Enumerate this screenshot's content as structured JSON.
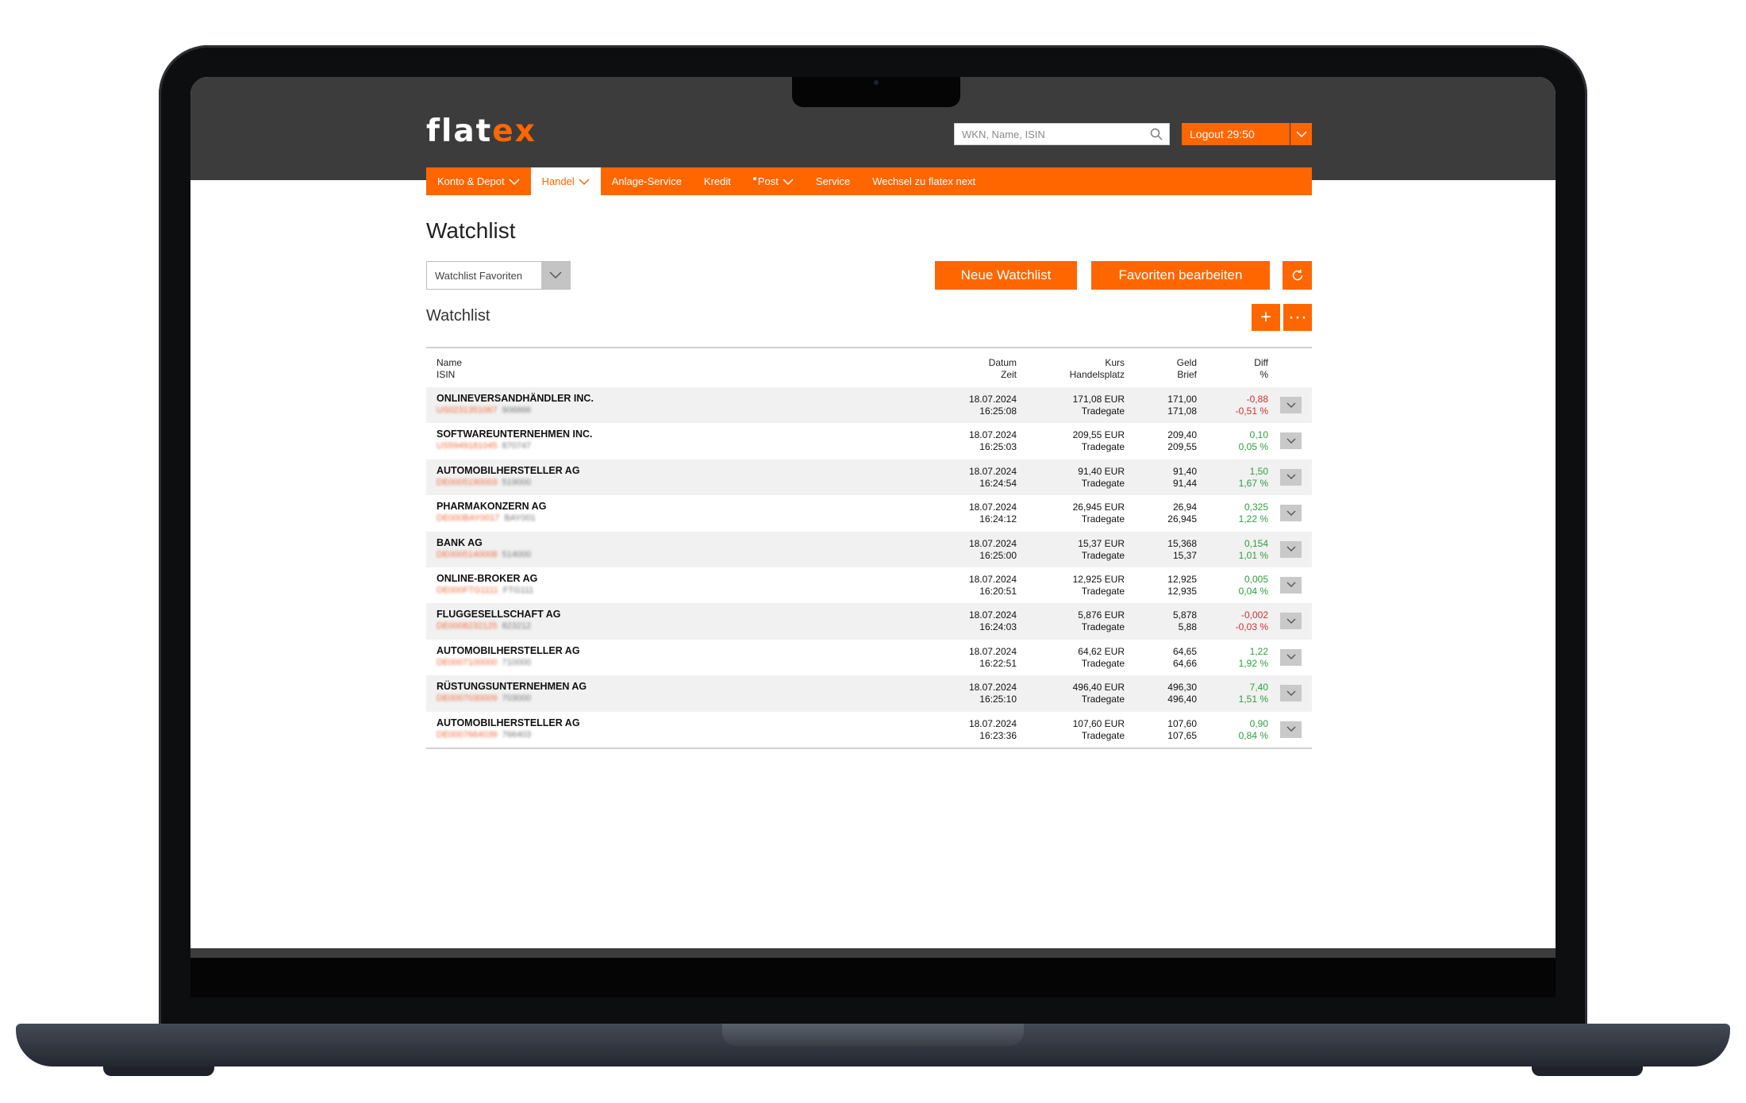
{
  "header": {
    "logo_text": "flat",
    "logo_accent": "ex",
    "search_placeholder": "WKN, Name, ISIN",
    "logout_label": "Logout  29:50"
  },
  "nav": {
    "items": [
      {
        "label": "Konto & Depot",
        "has_chevron": true
      },
      {
        "label": "Handel",
        "has_chevron": true,
        "active": true
      },
      {
        "label": "Anlage-Service"
      },
      {
        "label": "Kredit"
      },
      {
        "label": "Post",
        "has_chevron": true,
        "dot": true
      },
      {
        "label": "Service"
      },
      {
        "label": "Wechsel zu flatex next"
      }
    ]
  },
  "page": {
    "title": "Watchlist",
    "select_value": "Watchlist Favoriten",
    "btn_new": "Neue Watchlist",
    "btn_fav": "Favoriten bearbeiten",
    "section_title": "Watchlist",
    "btn_add": "+",
    "btn_more": "···"
  },
  "table": {
    "headers": {
      "name": "Name",
      "isin": "ISIN",
      "datum": "Datum",
      "zeit": "Zeit",
      "kurs": "Kurs",
      "handelsplatz": "Handelsplatz",
      "geld": "Geld",
      "brief": "Brief",
      "diff": "Diff",
      "pct": "%"
    },
    "rows": [
      {
        "name": "ONLINEVERSANDHÄNDLER INC.",
        "isin": "US0231351067",
        "wkn": "906866",
        "datum": "18.07.2024",
        "zeit": "16:25:08",
        "kurs": "171,08 EUR",
        "platz": "Tradegate",
        "geld": "171,00",
        "brief": "171,08",
        "diff": "-0,88",
        "pct": "-0,51 %",
        "trend": "neg"
      },
      {
        "name": "SOFTWAREUNTERNEHMEN INC.",
        "isin": "US5949181045",
        "wkn": "870747",
        "datum": "18.07.2024",
        "zeit": "16:25:03",
        "kurs": "209,55 EUR",
        "platz": "Tradegate",
        "geld": "209,40",
        "brief": "209,55",
        "diff": "0,10",
        "pct": "0,05 %",
        "trend": "pos"
      },
      {
        "name": "AUTOMOBILHERSTELLER AG",
        "isin": "DE0005190003",
        "wkn": "519000",
        "datum": "18.07.2024",
        "zeit": "16:24:54",
        "kurs": "91,40 EUR",
        "platz": "Tradegate",
        "geld": "91,40",
        "brief": "91,44",
        "diff": "1,50",
        "pct": "1,67 %",
        "trend": "pos"
      },
      {
        "name": "PHARMAKONZERN AG",
        "isin": "DE000BAY0017",
        "wkn": "BAY001",
        "datum": "18.07.2024",
        "zeit": "16:24:12",
        "kurs": "26,945 EUR",
        "platz": "Tradegate",
        "geld": "26,94",
        "brief": "26,945",
        "diff": "0,325",
        "pct": "1,22 %",
        "trend": "pos"
      },
      {
        "name": "BANK AG",
        "isin": "DE0005140008",
        "wkn": "514000",
        "datum": "18.07.2024",
        "zeit": "16:25:00",
        "kurs": "15,37 EUR",
        "platz": "Tradegate",
        "geld": "15,368",
        "brief": "15,37",
        "diff": "0,154",
        "pct": "1,01 %",
        "trend": "pos"
      },
      {
        "name": "ONLINE-BROKER AG",
        "isin": "DE000FTG1111",
        "wkn": "FTG111",
        "datum": "18.07.2024",
        "zeit": "16:20:51",
        "kurs": "12,925 EUR",
        "platz": "Tradegate",
        "geld": "12,925",
        "brief": "12,935",
        "diff": "0,005",
        "pct": "0,04 %",
        "trend": "pos"
      },
      {
        "name": "FLUGGESELLSCHAFT AG",
        "isin": "DE0008232125",
        "wkn": "823212",
        "datum": "18.07.2024",
        "zeit": "16:24:03",
        "kurs": "5,876 EUR",
        "platz": "Tradegate",
        "geld": "5,878",
        "brief": "5,88",
        "diff": "-0,002",
        "pct": "-0,03 %",
        "trend": "neg"
      },
      {
        "name": "AUTOMOBILHERSTELLER AG",
        "isin": "DE0007100000",
        "wkn": "710000",
        "datum": "18.07.2024",
        "zeit": "16:22:51",
        "kurs": "64,62 EUR",
        "platz": "Tradegate",
        "geld": "64,65",
        "brief": "64,66",
        "diff": "1,22",
        "pct": "1,92 %",
        "trend": "pos"
      },
      {
        "name": "RÜSTUNGSUNTERNEHMEN AG",
        "isin": "DE0007030009",
        "wkn": "703000",
        "datum": "18.07.2024",
        "zeit": "16:25:10",
        "kurs": "496,40 EUR",
        "platz": "Tradegate",
        "geld": "496,30",
        "brief": "496,40",
        "diff": "7,40",
        "pct": "1,51 %",
        "trend": "pos"
      },
      {
        "name": "AUTOMOBILHERSTELLER AG",
        "isin": "DE0007664039",
        "wkn": "766403",
        "datum": "18.07.2024",
        "zeit": "16:23:36",
        "kurs": "107,60 EUR",
        "platz": "Tradegate",
        "geld": "107,60",
        "brief": "107,65",
        "diff": "0,90",
        "pct": "0,84 %",
        "trend": "pos"
      }
    ]
  },
  "colors": {
    "accent": "#ff6600",
    "header_bg": "#3c3c3c",
    "negative": "#d32f2f",
    "positive": "#2e9e3e"
  }
}
